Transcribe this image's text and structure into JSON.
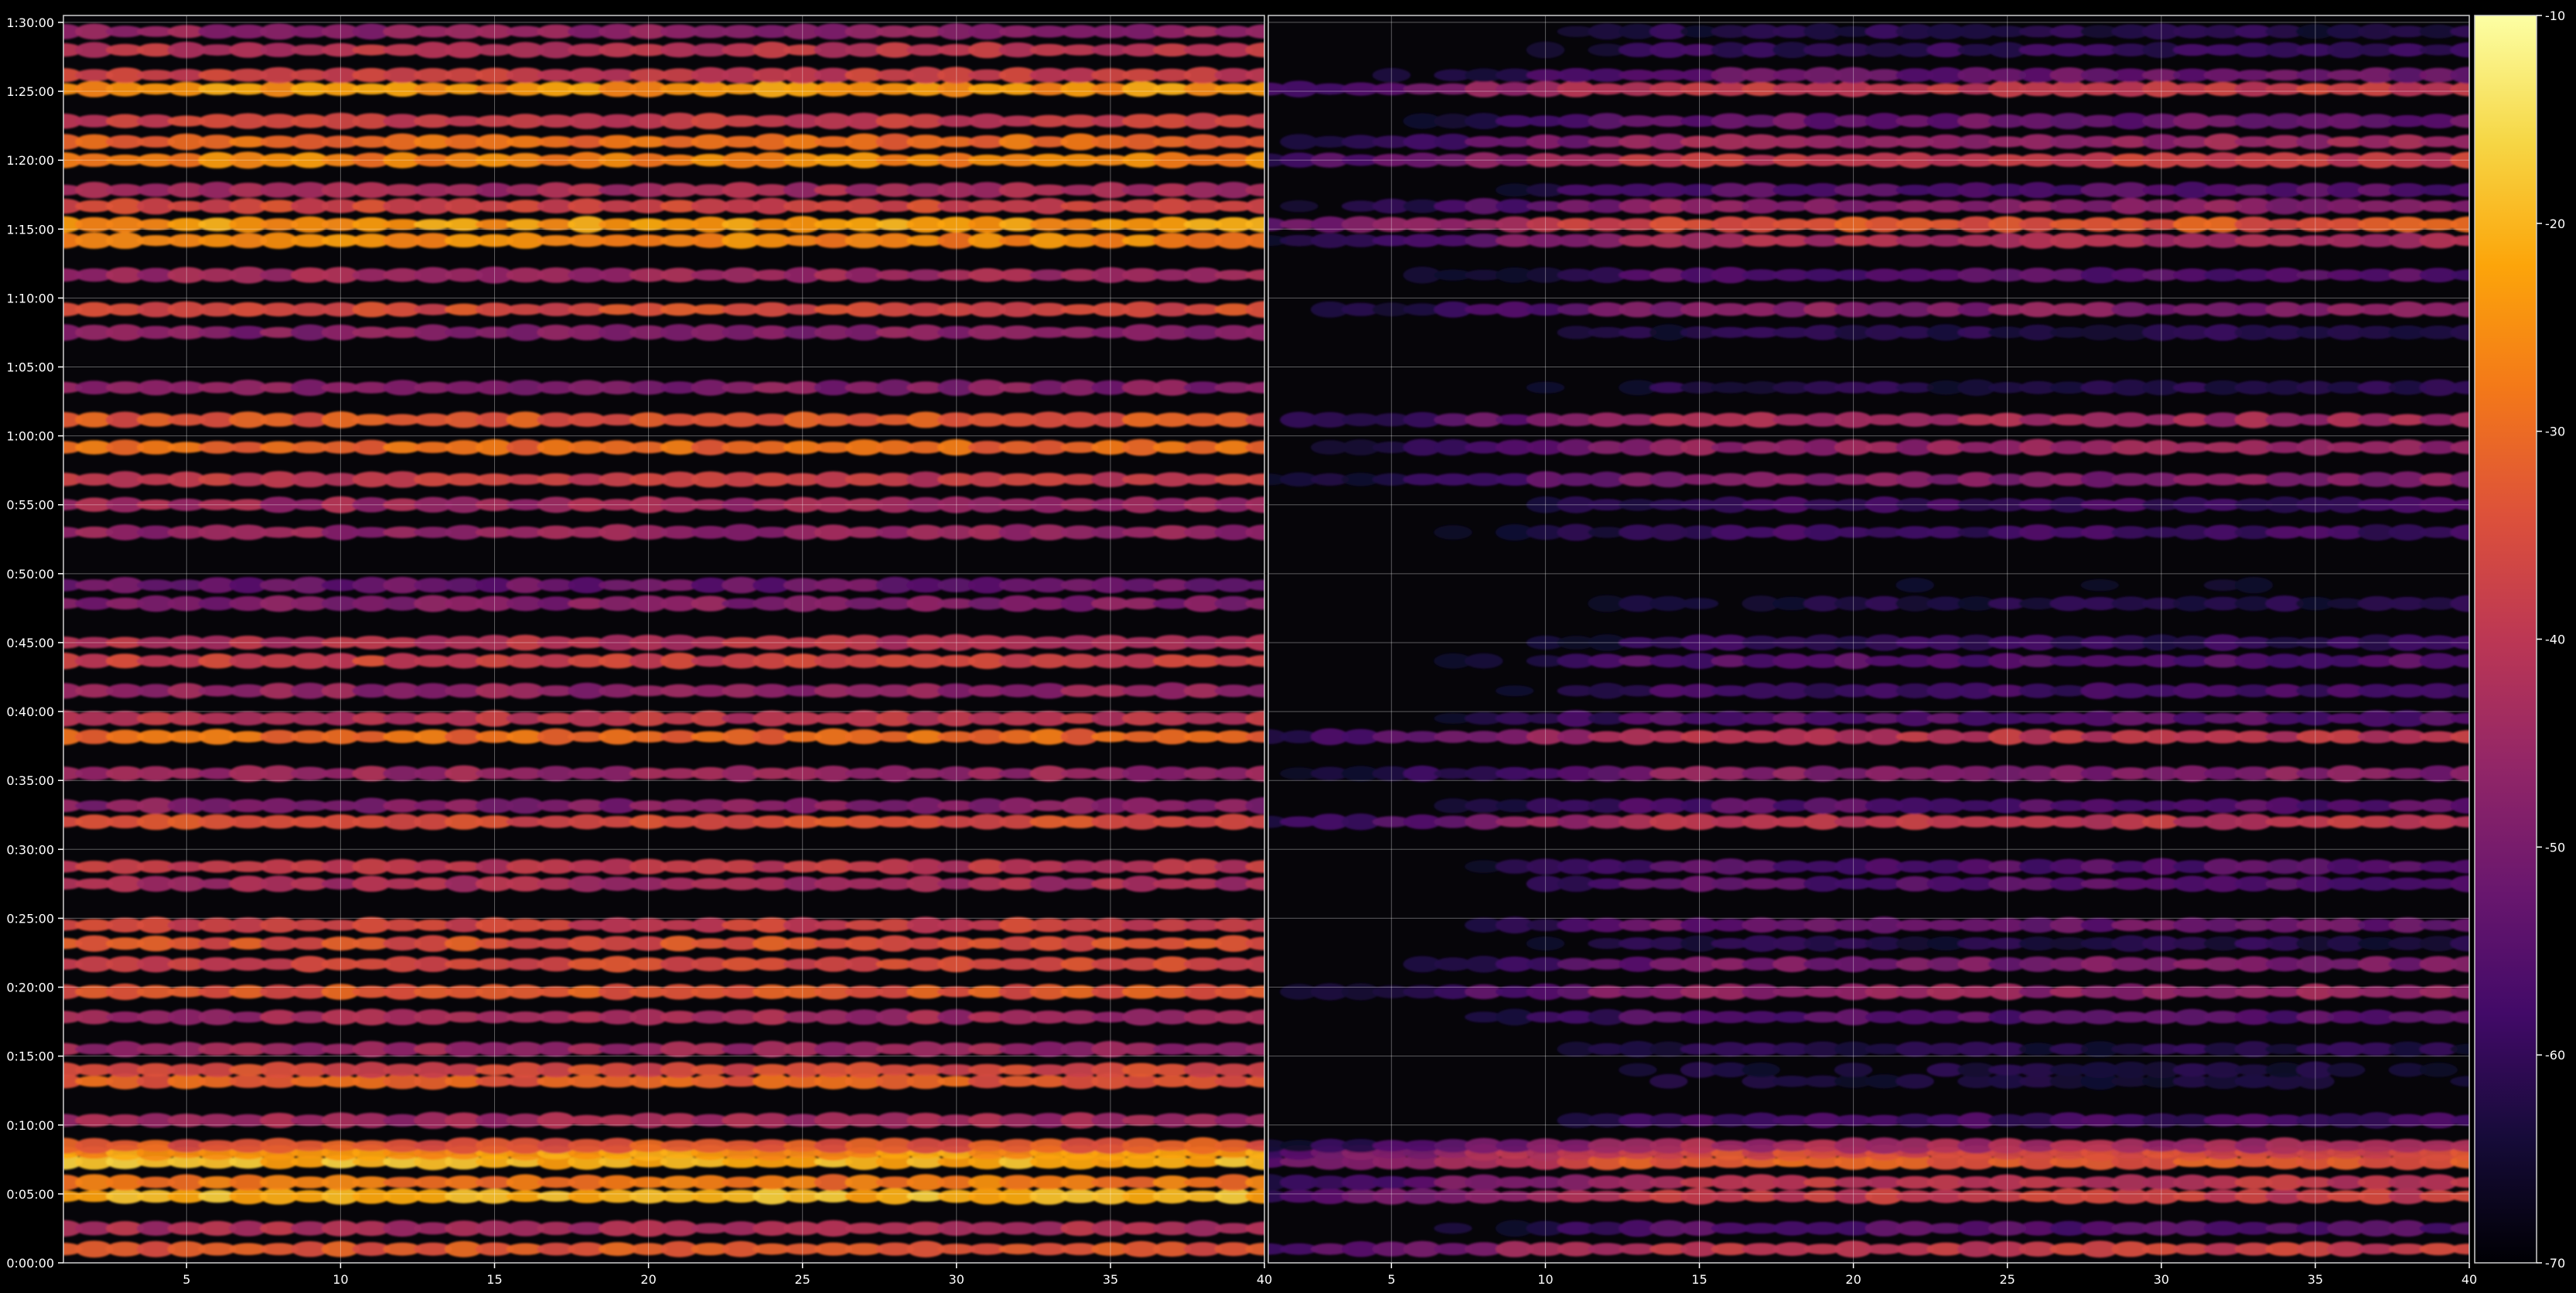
{
  "chart_data": {
    "type": "heatmap",
    "title": "",
    "xlabel": "",
    "ylabel": "",
    "colormap": "inferno",
    "background": "#000000",
    "grid": true,
    "panels": [
      {
        "name": "",
        "xlim": [
          1,
          40
        ],
        "x_ticks": [
          "5",
          "10",
          "15",
          "20",
          "25",
          "30",
          "35",
          "40"
        ],
        "x_tick_values": [
          5,
          10,
          15,
          20,
          25,
          30,
          35,
          40
        ]
      },
      {
        "name": "",
        "xlim": [
          1,
          40
        ],
        "x_ticks": [
          "5",
          "10",
          "15",
          "20",
          "25",
          "30",
          "35",
          "40"
        ],
        "x_tick_values": [
          5,
          10,
          15,
          20,
          25,
          30,
          35,
          40
        ]
      }
    ],
    "y_axis": {
      "unit": "seconds",
      "ylim": [
        0,
        5430
      ],
      "ticks": [
        "0:00:00",
        "0:05:00",
        "0:10:00",
        "0:15:00",
        "0:20:00",
        "0:25:00",
        "0:30:00",
        "0:35:00",
        "0:40:00",
        "0:45:00",
        "0:50:00",
        "0:55:00",
        "1:00:00",
        "1:05:00",
        "1:10:00",
        "1:15:00",
        "1:20:00",
        "1:25:00",
        "1:30:00"
      ],
      "tick_values": [
        0,
        300,
        600,
        900,
        1200,
        1500,
        1800,
        2100,
        2400,
        2700,
        3000,
        3300,
        3600,
        3900,
        4200,
        4500,
        4800,
        5100,
        5400
      ]
    },
    "colorbar": {
      "vmin": -70,
      "vmax": -10,
      "ticks": [
        "-10",
        "-20",
        "-30",
        "-40",
        "-50",
        "-60",
        "-70"
      ],
      "tick_values": [
        -10,
        -20,
        -30,
        -40,
        -50,
        -60,
        -70
      ]
    },
    "bands": [
      {
        "t": 60,
        "left": -33,
        "right": -38
      },
      {
        "t": 150,
        "left": -42,
        "right": -55
      },
      {
        "t": 290,
        "left": -20,
        "right": -38
      },
      {
        "t": 350,
        "left": -28,
        "right": -40
      },
      {
        "t": 440,
        "left": -20,
        "right": -32
      },
      {
        "t": 480,
        "left": -24,
        "right": -35
      },
      {
        "t": 510,
        "left": -33,
        "right": -43
      },
      {
        "t": 620,
        "left": -44,
        "right": -58
      },
      {
        "t": 790,
        "left": -32,
        "right": -65
      },
      {
        "t": 840,
        "left": -35,
        "right": -64
      },
      {
        "t": 930,
        "left": -45,
        "right": -62
      },
      {
        "t": 1070,
        "left": -44,
        "right": -55
      },
      {
        "t": 1180,
        "left": -33,
        "right": -46
      },
      {
        "t": 1300,
        "left": -36,
        "right": -50
      },
      {
        "t": 1390,
        "left": -34,
        "right": -62
      },
      {
        "t": 1470,
        "left": -37,
        "right": -52
      },
      {
        "t": 1650,
        "left": -43,
        "right": -55
      },
      {
        "t": 1725,
        "left": -40,
        "right": -55
      },
      {
        "t": 1920,
        "left": -35,
        "right": -40
      },
      {
        "t": 1990,
        "left": -48,
        "right": -55
      },
      {
        "t": 2130,
        "left": -45,
        "right": -48
      },
      {
        "t": 2290,
        "left": -30,
        "right": -40
      },
      {
        "t": 2370,
        "left": -40,
        "right": -55
      },
      {
        "t": 2490,
        "left": -46,
        "right": -58
      },
      {
        "t": 2620,
        "left": -37,
        "right": -55
      },
      {
        "t": 2700,
        "left": -41,
        "right": -60
      },
      {
        "t": 2870,
        "left": -48,
        "right": -63
      },
      {
        "t": 2950,
        "left": -52,
        "right": -68
      },
      {
        "t": 3180,
        "left": -46,
        "right": -58
      },
      {
        "t": 3300,
        "left": -44,
        "right": -58
      },
      {
        "t": 3410,
        "left": -39,
        "right": -48
      },
      {
        "t": 3550,
        "left": -30,
        "right": -46
      },
      {
        "t": 3670,
        "left": -33,
        "right": -44
      },
      {
        "t": 3810,
        "left": -48,
        "right": -62
      },
      {
        "t": 4050,
        "left": -48,
        "right": -62
      },
      {
        "t": 4150,
        "left": -35,
        "right": -48
      },
      {
        "t": 4300,
        "left": -44,
        "right": -55
      },
      {
        "t": 4450,
        "left": -26,
        "right": -42
      },
      {
        "t": 4520,
        "left": -23,
        "right": -33
      },
      {
        "t": 4600,
        "left": -36,
        "right": -47
      },
      {
        "t": 4670,
        "left": -43,
        "right": -55
      },
      {
        "t": 4800,
        "left": -26,
        "right": -38
      },
      {
        "t": 4880,
        "left": -30,
        "right": -45
      },
      {
        "t": 4970,
        "left": -38,
        "right": -52
      },
      {
        "t": 5110,
        "left": -24,
        "right": -38
      },
      {
        "t": 5170,
        "left": -38,
        "right": -52
      },
      {
        "t": 5280,
        "left": -40,
        "right": -60
      },
      {
        "t": 5360,
        "left": -46,
        "right": -62
      }
    ]
  }
}
